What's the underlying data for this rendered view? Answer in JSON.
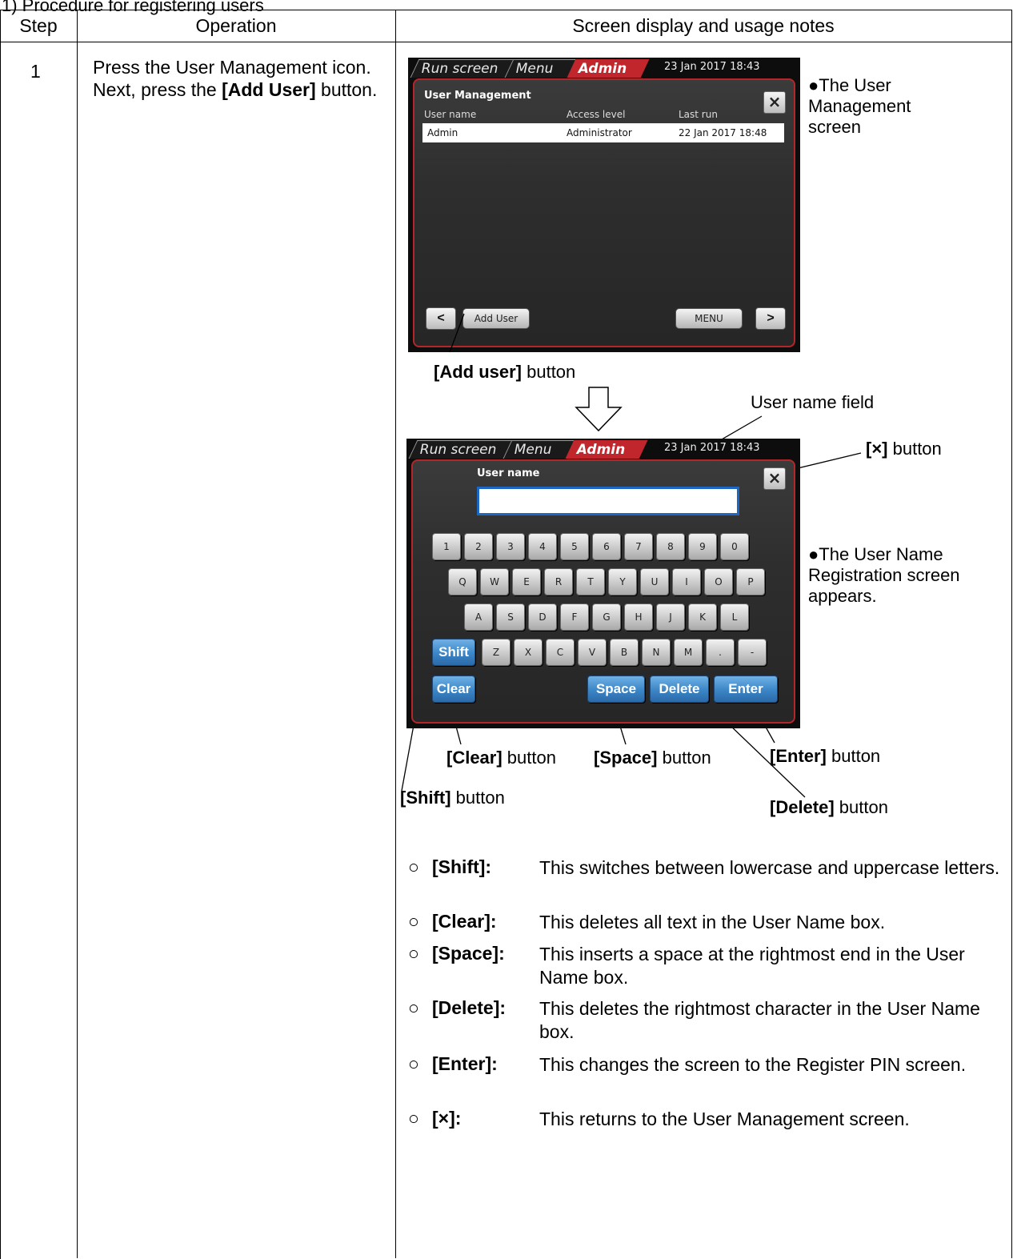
{
  "header_text": "1) Procedure for registering users",
  "table": {
    "col_step": "Step",
    "col_operation": "Operation",
    "col_notes": "Screen display and usage notes"
  },
  "step": {
    "number": "1",
    "op_text_1": "Press the User Management icon. Next, press the ",
    "op_bold_1": "[Add User]",
    "op_text_2": " button."
  },
  "screen1": {
    "tab_run": "Run screen",
    "tab_menu": "Menu",
    "tab_admin": "Admin",
    "datetime": "23  Jan  2017  18:43",
    "title": "User Management",
    "close": "×",
    "col_user": "User name",
    "col_access": "Access level",
    "col_last": "Last run",
    "rows": [
      {
        "user": "Admin",
        "access": "Administrator",
        "last": "22 Jan 2017 18:48"
      }
    ],
    "btn_prev": "<",
    "btn_add": "Add User",
    "btn_menu": "MENU",
    "btn_next": ">"
  },
  "screen2": {
    "tab_run": "Run screen",
    "tab_menu": "Menu",
    "tab_admin": "Admin",
    "datetime": "23  Jan  2017  18:43",
    "label_user": "User name",
    "close": "×",
    "row1": [
      "1",
      "2",
      "3",
      "4",
      "5",
      "6",
      "7",
      "8",
      "9",
      "0"
    ],
    "row2": [
      "Q",
      "W",
      "E",
      "R",
      "T",
      "Y",
      "U",
      "I",
      "O",
      "P"
    ],
    "row3": [
      "A",
      "S",
      "D",
      "F",
      "G",
      "H",
      "J",
      "K",
      "L"
    ],
    "row4": [
      "Z",
      "X",
      "C",
      "V",
      "B",
      "N",
      "M",
      ".",
      "-"
    ],
    "key_shift": "Shift",
    "key_clear": "Clear",
    "key_space": "Space",
    "key_delete": "Delete",
    "key_enter": "Enter"
  },
  "callouts": {
    "add_user_bold": "[Add user]",
    "add_user_rest": " button",
    "user_name_field": "User name field",
    "x_bold": "[×]",
    "x_rest": " button",
    "clear_bold": "[Clear]",
    "clear_rest": " button",
    "space_bold": "[Space]",
    "space_rest": " button",
    "enter_bold": "[Enter]",
    "enter_rest": " button",
    "shift_bold": "[Shift]",
    "shift_rest": " button",
    "delete_bold": "[Delete]",
    "delete_rest": " button"
  },
  "side_notes": {
    "note1": "●The User Management screen",
    "note2": "●The User Name Registration screen appears."
  },
  "usage_notes": [
    {
      "circle": "○",
      "label": "[Shift]:",
      "text": "This switches between lowercase and uppercase letters."
    },
    {
      "circle": "○",
      "label": "[Clear]:",
      "text": "This deletes all text in the User Name box."
    },
    {
      "circle": "○",
      "label": "[Space]:",
      "text": "This inserts a space at the rightmost end in the User Name box."
    },
    {
      "circle": "○",
      "label": "[Delete]:",
      "text": "This deletes the rightmost character in the User Name box."
    },
    {
      "circle": "○",
      "label": "[Enter]:",
      "text": "This changes the screen to the Register PIN screen."
    },
    {
      "circle": "○",
      "label": "[×]:",
      "text": "This returns to the User Management screen."
    }
  ]
}
